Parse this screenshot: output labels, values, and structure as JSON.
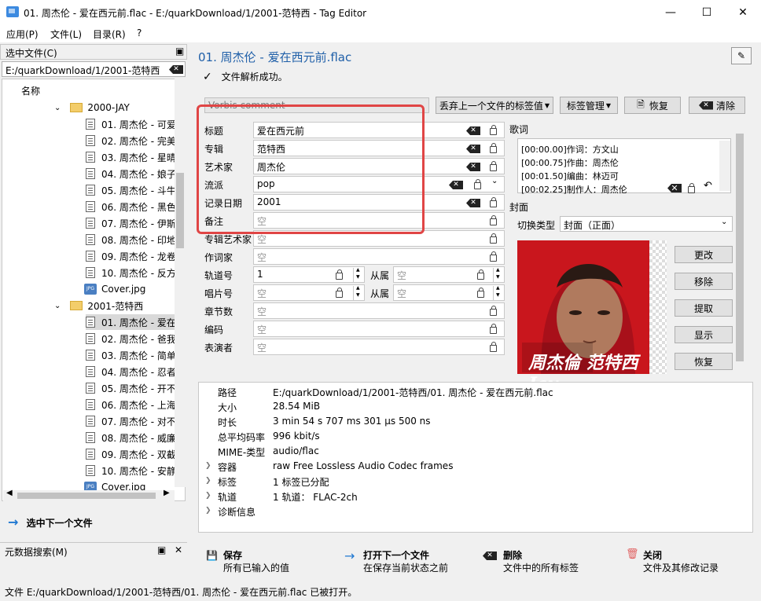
{
  "window": {
    "title": "01. 周杰伦 - 爱在西元前.flac - E:/quarkDownload/1/2001-范特西 - Tag Editor"
  },
  "menu": [
    "应用(P)",
    "文件(L)",
    "目录(R)",
    "?"
  ],
  "left": {
    "header": "选中文件(C)",
    "path": "E:/quarkDownload/1/2001-范特西",
    "column": "名称",
    "tree": [
      {
        "type": "folder",
        "label": "2000-JAY"
      },
      {
        "type": "file",
        "label": "01. 周杰伦 - 可爱"
      },
      {
        "type": "file",
        "label": "02. 周杰伦 - 完美"
      },
      {
        "type": "file",
        "label": "03. 周杰伦 - 星晴"
      },
      {
        "type": "file",
        "label": "04. 周杰伦 - 娘子"
      },
      {
        "type": "file",
        "label": "05. 周杰伦 - 斗牛"
      },
      {
        "type": "file",
        "label": "06. 周杰伦 - 黑色"
      },
      {
        "type": "file",
        "label": "07. 周杰伦 - 伊斯"
      },
      {
        "type": "file",
        "label": "08. 周杰伦 - 印地"
      },
      {
        "type": "file",
        "label": "09. 周杰伦 - 龙卷"
      },
      {
        "type": "file",
        "label": "10. 周杰伦 - 反方"
      },
      {
        "type": "image",
        "label": "Cover.jpg"
      },
      {
        "type": "folder",
        "label": "2001-范特西"
      },
      {
        "type": "file",
        "label": "01. 周杰伦 - 爱在",
        "selected": true
      },
      {
        "type": "file",
        "label": "02. 周杰伦 - 爸我"
      },
      {
        "type": "file",
        "label": "03. 周杰伦 - 简单"
      },
      {
        "type": "file",
        "label": "04. 周杰伦 - 忍者"
      },
      {
        "type": "file",
        "label": "05. 周杰伦 - 开不"
      },
      {
        "type": "file",
        "label": "06. 周杰伦 - 上海"
      },
      {
        "type": "file",
        "label": "07. 周杰伦 - 对不"
      },
      {
        "type": "file",
        "label": "08. 周杰伦 - 威廉"
      },
      {
        "type": "file",
        "label": "09. 周杰伦 - 双截"
      },
      {
        "type": "file",
        "label": "10. 周杰伦 - 安静"
      },
      {
        "type": "image",
        "label": "Cover.jpg"
      }
    ],
    "next_file": "选中下一个文件",
    "meta_search": "元数据搜索(M)"
  },
  "main": {
    "file_title": "01. 周杰伦 - 爱在西元前.flac",
    "parse_status": "文件解析成功。",
    "tag_format": "Vorbis comment",
    "discard_btn": "丢弃上一个文件的标签值",
    "tag_mgmt_btn": "标签管理",
    "restore_btn": "恢复",
    "clear_btn": "清除",
    "fields": [
      {
        "label": "标题",
        "value": "爱在西元前"
      },
      {
        "label": "专辑",
        "value": "范特西"
      },
      {
        "label": "艺术家",
        "value": "周杰伦"
      },
      {
        "label": "流派",
        "value": "pop"
      },
      {
        "label": "记录日期",
        "value": "2001"
      },
      {
        "label": "备注",
        "value": "空"
      },
      {
        "label": "专辑艺术家",
        "value": "空"
      },
      {
        "label": "作词家",
        "value": "空"
      },
      {
        "label": "轨道号",
        "value": "1",
        "of_label": "从属",
        "of_value": "空"
      },
      {
        "label": "唱片号",
        "value": "空",
        "of_label": "从属",
        "of_value": "空"
      },
      {
        "label": "章节数",
        "value": "空"
      },
      {
        "label": "编码",
        "value": "空"
      },
      {
        "label": "表演者",
        "value": "空"
      }
    ],
    "lyrics_label": "歌词",
    "lyrics": [
      "[00:00.00]作词：方文山",
      "[00:00.75]作曲：周杰伦",
      "[00:01.50]编曲：林迈可",
      "[00:02.25]制作人：周杰伦"
    ],
    "cover_label": "封面",
    "switch_type_label": "切换类型",
    "cover_type": "封面（正面）",
    "cover_buttons": [
      "更改",
      "移除",
      "提取",
      "显示",
      "恢复"
    ],
    "album_art_text": "周杰倫 范特西 Jay",
    "info": [
      {
        "key": "路径",
        "value": "E:/quarkDownload/1/2001-范特西/01. 周杰伦 - 爱在西元前.flac"
      },
      {
        "key": "大小",
        "value": "28.54 MiB"
      },
      {
        "key": "时长",
        "value": "3 min 54 s 707 ms 301 µs 500 ns"
      },
      {
        "key": "总平均码率",
        "value": "996 kbit/s"
      },
      {
        "key": "MIME-类型",
        "value": "audio/flac"
      },
      {
        "key": "容器",
        "value": "raw Free Lossless Audio Codec frames",
        "expand": true
      },
      {
        "key": "标签",
        "value": "1 标签已分配",
        "expand": true
      },
      {
        "key": "轨道",
        "value": "1 轨道： FLAC-2ch",
        "expand": true
      },
      {
        "key": "诊断信息",
        "value": "",
        "expand": true
      }
    ],
    "bottom": [
      {
        "title": "保存",
        "sub": "所有已输入的值"
      },
      {
        "title": "打开下一个文件",
        "sub": "在保存当前状态之前"
      },
      {
        "title": "删除",
        "sub": "文件中的所有标签"
      },
      {
        "title": "关闭",
        "sub": "文件及其修改记录"
      }
    ]
  },
  "status": "文件 E:/quarkDownload/1/2001-范特西/01. 周杰伦 - 爱在西元前.flac 已被打开。",
  "colors": {
    "accent": "#1f5fa8",
    "highlight": "#e04545"
  }
}
